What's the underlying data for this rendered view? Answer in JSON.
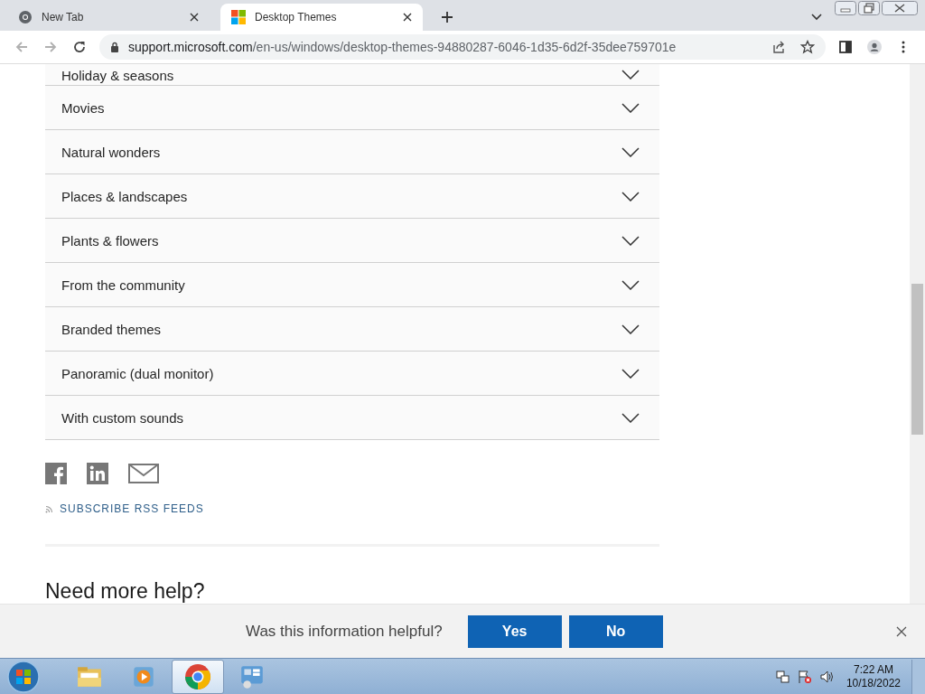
{
  "tabs": [
    {
      "title": "New Tab",
      "selected": false,
      "kind": "chrome"
    },
    {
      "title": "Desktop Themes",
      "selected": true,
      "kind": "microsoft"
    }
  ],
  "address": {
    "host": "support.microsoft.com",
    "path": "/en-us/windows/desktop-themes-94880287-6046-1d35-6d2f-35dee759701e"
  },
  "accordion": [
    {
      "label": "Holiday & seasons",
      "expanded": false,
      "partial": true
    },
    {
      "label": "Movies",
      "expanded": false
    },
    {
      "label": "Natural wonders",
      "expanded": false
    },
    {
      "label": "Places & landscapes",
      "expanded": false
    },
    {
      "label": "Plants & flowers",
      "expanded": false
    },
    {
      "label": "From the community",
      "expanded": false
    },
    {
      "label": "Branded themes",
      "expanded": false
    },
    {
      "label": "Panoramic (dual monitor)",
      "expanded": false
    },
    {
      "label": "With custom sounds",
      "expanded": false
    }
  ],
  "share": [
    {
      "kind": "facebook"
    },
    {
      "kind": "linkedin"
    },
    {
      "kind": "email"
    }
  ],
  "rss_link": "SUBSCRIBE RSS FEEDS",
  "heading": "Need more help?",
  "feedback": {
    "question": "Was this information helpful?",
    "buttons": [
      "Yes",
      "No"
    ]
  },
  "taskbar": {
    "apps": [
      {
        "kind": "folder",
        "selected": false
      },
      {
        "kind": "media",
        "selected": false
      },
      {
        "kind": "chrome",
        "selected": true
      },
      {
        "kind": "control",
        "selected": false
      }
    ],
    "time": "7:22 AM",
    "date": "10/18/2022"
  }
}
